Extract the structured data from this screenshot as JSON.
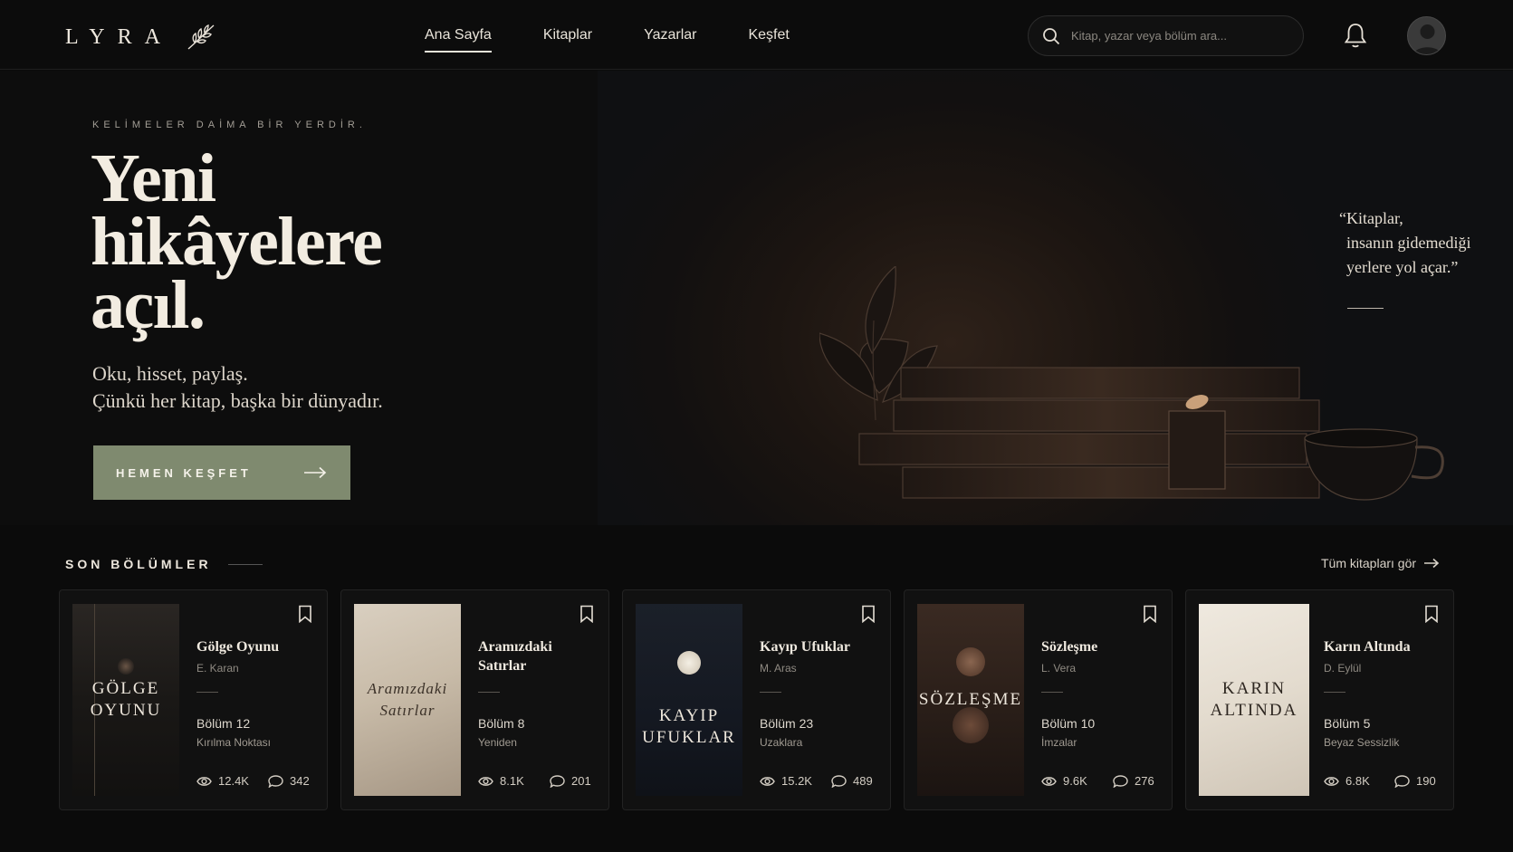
{
  "brand": {
    "name": "LYRA",
    "icon": "olive-branch-icon"
  },
  "nav": {
    "items": [
      {
        "label": "Ana Sayfa",
        "active": true
      },
      {
        "label": "Kitaplar",
        "active": false
      },
      {
        "label": "Yazarlar",
        "active": false
      },
      {
        "label": "Keşfet",
        "active": false
      }
    ]
  },
  "search": {
    "placeholder": "Kitap, yazar veya bölüm ara...",
    "value": ""
  },
  "hero": {
    "eyebrow": "KELİMELER DAİMA BİR YERDİR.",
    "title_lines": [
      "Yeni",
      "hikâyelere",
      "açıl."
    ],
    "subtitle_lines": [
      "Oku, hisset, paylaş.",
      "Çünkü her kitap, başka bir dünyadır."
    ],
    "cta_label": "HEMEN KEŞFET",
    "quote_lines": [
      "“Kitaplar,",
      "insanın gidemediği",
      "yerlere yol açar.”"
    ],
    "cta_color": "#7f8a6f"
  },
  "recent": {
    "title": "SON BÖLÜMLER",
    "see_all": "Tüm kitapları gör",
    "cards": [
      {
        "title": "Gölge Oyunu",
        "cover_text": [
          "GÖLGE",
          "OYUNU"
        ],
        "author": "E. Karan",
        "chapter": "Bölüm 12",
        "chapter_title": "Kırılma Noktası",
        "views": "12.4K",
        "comments": "342"
      },
      {
        "title": "Aramızdaki Satırlar",
        "cover_text": [
          "Aramızdaki",
          "Satırlar"
        ],
        "author": "",
        "chapter": "Bölüm 8",
        "chapter_title": "Yeniden",
        "views": "8.1K",
        "comments": "201"
      },
      {
        "title": "Kayıp Ufuklar",
        "cover_text": [
          "KAYIP",
          "UFUKLAR"
        ],
        "author": "M. Aras",
        "chapter": "Bölüm 23",
        "chapter_title": "Uzaklara",
        "views": "15.2K",
        "comments": "489"
      },
      {
        "title": "Sözleşme",
        "cover_text": [
          "SÖZLEŞME"
        ],
        "author": "L. Vera",
        "chapter": "Bölüm 10",
        "chapter_title": "İmzalar",
        "views": "9.6K",
        "comments": "276"
      },
      {
        "title": "Karın Altında",
        "cover_text": [
          "KARIN",
          "ALTINDA"
        ],
        "author": "D. Eylül",
        "chapter": "Bölüm 5",
        "chapter_title": "Beyaz Sessizlik",
        "views": "6.8K",
        "comments": "190"
      }
    ]
  }
}
